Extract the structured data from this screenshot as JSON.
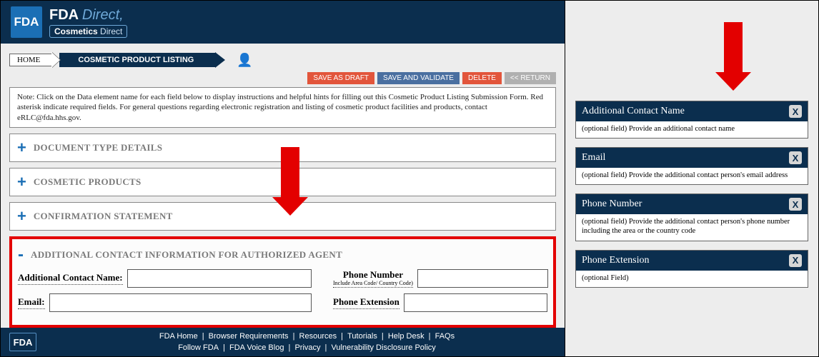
{
  "header": {
    "logoText": "FDA",
    "direct1": "FDA ",
    "direct2": "Direct,",
    "cos1": "Cosmetics ",
    "cos2": "Direct"
  },
  "breadcrumb": {
    "home": "HOME",
    "current": "COSMETIC PRODUCT LISTING"
  },
  "buttons": {
    "saveDraft": "SAVE AS DRAFT",
    "saveValidate": "SAVE AND VALIDATE",
    "delete": "DELETE",
    "return": "<< RETURN"
  },
  "note": "Note: Click on the Data element name for each field below to display instructions and helpful hints for filling out this Cosmetic Product Listing Submission Form. Red asterisk indicate required fields. For general questions regarding electronic registration and listing of cosmetic product facilities and products, contact eRLC@fda.hhs.gov.",
  "acc": {
    "a1": "DOCUMENT TYPE DETAILS",
    "a2": "COSMETIC PRODUCTS",
    "a3": "CONFIRMATION STATEMENT",
    "a4": "ADDITIONAL CONTACT INFORMATION FOR AUTHORIZED AGENT"
  },
  "form": {
    "contactName": "Additional Contact Name:",
    "phone": "Phone Number",
    "phoneSub": "Include Area Code/ Country Code)",
    "email": "Email:",
    "ext": "Phone Extension"
  },
  "footer": {
    "logo": "FDA",
    "row1": [
      "FDA Home",
      "Browser Requirements",
      "Resources",
      "Tutorials",
      "Help Desk",
      "FAQs"
    ],
    "row2": [
      "Follow FDA",
      "FDA Voice Blog",
      "Privacy",
      "Vulnerability Disclosure Policy"
    ]
  },
  "help": [
    {
      "title": "Additional Contact Name",
      "body": "(optional field) Provide an additional contact name"
    },
    {
      "title": "Email",
      "body": "(optional field) Provide the additional contact person's email address"
    },
    {
      "title": "Phone Number",
      "body": "(optional field) Provide the additional contact person's phone number including the area or the country code"
    },
    {
      "title": "Phone Extension",
      "body": "(optional Field)"
    }
  ]
}
